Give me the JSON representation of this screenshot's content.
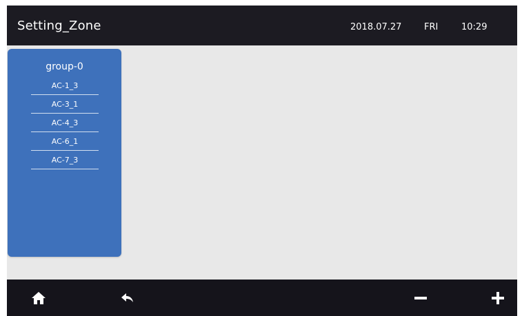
{
  "header": {
    "title": "Setting_Zone",
    "date": "2018.07.27",
    "day": "FRI",
    "time": "10:29"
  },
  "group": {
    "title": "group-0",
    "items": [
      {
        "label": "AC-1_3"
      },
      {
        "label": "AC-3_1"
      },
      {
        "label": "AC-4_3"
      },
      {
        "label": "AC-6_1"
      },
      {
        "label": "AC-7_3"
      }
    ]
  },
  "toolbar": {
    "home_icon": "home-icon",
    "back_icon": "back-arrow-icon",
    "minus_icon": "minus-icon",
    "plus_icon": "plus-icon"
  },
  "colors": {
    "header": "#1c1b22",
    "footer": "#15141b",
    "background": "#e8e8e8",
    "panel": "#3e71bb",
    "text": "#ffffff"
  }
}
